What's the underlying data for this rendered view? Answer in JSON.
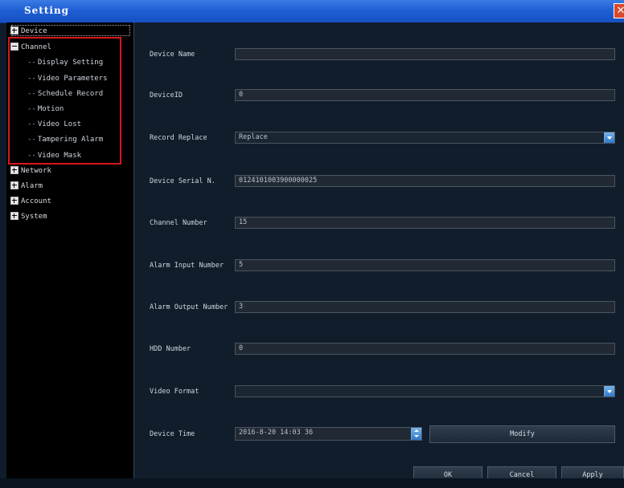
{
  "window": {
    "title": "Setting"
  },
  "tree": {
    "device": "Device",
    "channel": "Channel",
    "channel_children": [
      "Display Setting",
      "Video Parameters",
      "Schedule Record",
      "Motion",
      "Video Lost",
      "Tampering Alarm",
      "Video Mask"
    ],
    "network": "Network",
    "alarm": "Alarm",
    "account": "Account",
    "system": "System"
  },
  "form": {
    "device_name": {
      "label": "Device Name",
      "value": ""
    },
    "device_id": {
      "label": "DeviceID",
      "value": "0"
    },
    "record_replace": {
      "label": "Record Replace",
      "value": "Replace"
    },
    "serial": {
      "label": "Device Serial N.",
      "value": "0124101003900000025"
    },
    "channel_number": {
      "label": "Channel Number",
      "value": "15"
    },
    "alarm_input": {
      "label": "Alarm Input Number",
      "value": "5"
    },
    "alarm_output": {
      "label": "Alarm Output Number",
      "value": "3"
    },
    "hdd_number": {
      "label": "HDD Number",
      "value": "0"
    },
    "video_format": {
      "label": "Video Format",
      "value": ""
    },
    "device_time": {
      "label": "Device Time",
      "value": "2016-8-20 14:03 36"
    }
  },
  "buttons": {
    "modify": "Modify",
    "ok": "OK",
    "cancel": "Cancel",
    "apply": "Apply"
  },
  "icons": {
    "close": "close-icon",
    "expand": "tree-expand-icon"
  },
  "colors": {
    "highlight": "#d9161b",
    "titlebar": "#1f5fd4"
  }
}
